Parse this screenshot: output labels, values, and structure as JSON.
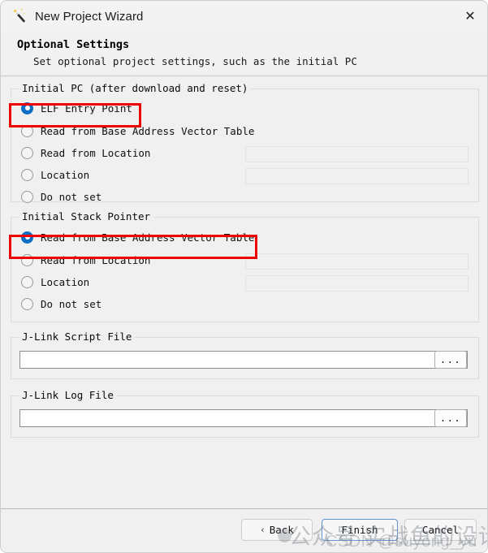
{
  "window": {
    "title": "New Project Wizard",
    "icon": "magic-wand-icon",
    "close_label": "✕"
  },
  "header": {
    "title": "Optional Settings",
    "subtitle": "Set optional project settings, such as the initial PC"
  },
  "groups": [
    {
      "legend": "Initial PC (after download and reset)",
      "options": [
        {
          "label": "ELF Entry Point",
          "checked": true,
          "has_field": false,
          "field_value": "",
          "highlighted": true
        },
        {
          "label": "Read from Base Address Vector Table",
          "checked": false,
          "has_field": false,
          "field_value": "",
          "highlighted": false
        },
        {
          "label": "Read from Location",
          "checked": false,
          "has_field": true,
          "field_value": "",
          "highlighted": false
        },
        {
          "label": "Location",
          "checked": false,
          "has_field": true,
          "field_value": "",
          "highlighted": false
        },
        {
          "label": "Do not set",
          "checked": false,
          "has_field": false,
          "field_value": "",
          "highlighted": false
        }
      ]
    },
    {
      "legend": "Initial Stack Pointer",
      "options": [
        {
          "label": "Read from Base Address Vector Table",
          "checked": true,
          "has_field": false,
          "field_value": "",
          "highlighted": true
        },
        {
          "label": "Read from Location",
          "checked": false,
          "has_field": true,
          "field_value": "",
          "highlighted": false
        },
        {
          "label": "Location",
          "checked": false,
          "has_field": true,
          "field_value": "",
          "highlighted": false
        },
        {
          "label": "Do not set",
          "checked": false,
          "has_field": false,
          "field_value": "",
          "highlighted": false
        }
      ]
    }
  ],
  "file_groups": [
    {
      "legend": "J-Link Script File",
      "value": "",
      "browse_label": "..."
    },
    {
      "legend": "J-Link Log File",
      "value": "",
      "browse_label": "..."
    }
  ],
  "footer": {
    "back_label": "Back",
    "back_chevron": "‹",
    "finish_label": "Finish",
    "cancel_label": "Cancel"
  },
  "watermark": {
    "chinese": "公众号 实战鱼的设计笔本",
    "csdn": "CSDN @suyong_yu"
  },
  "colors": {
    "accent": "#0c6fc6",
    "highlight": "#ee0000",
    "window_bg": "#f0f0f0",
    "default_button_border": "#5f94d6"
  }
}
